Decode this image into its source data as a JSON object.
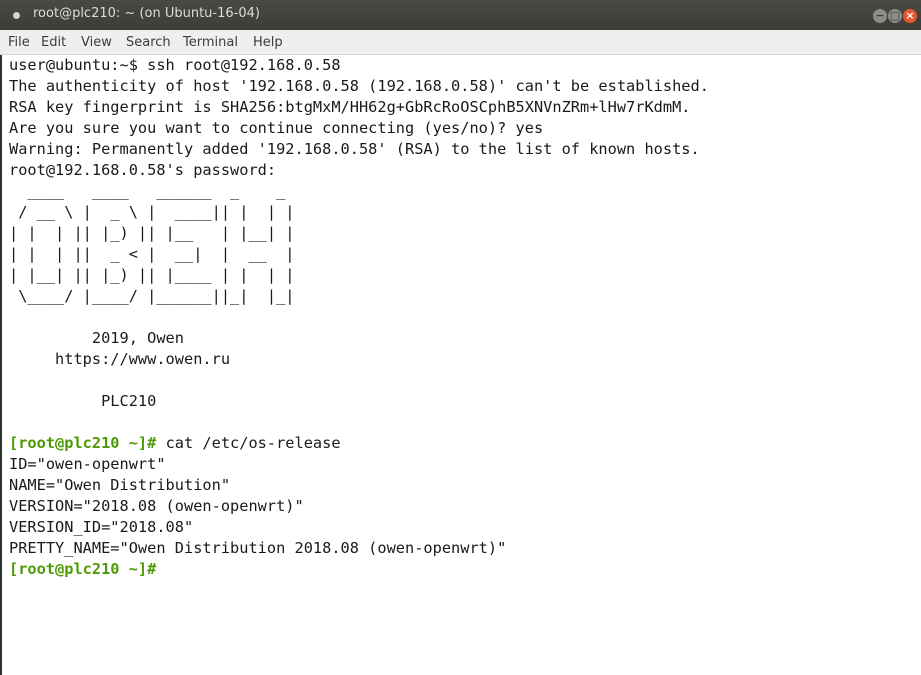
{
  "window": {
    "title": "root@plc210: ~ (on Ubuntu-16-04)",
    "controls": {
      "minimize": "−",
      "maximize": "□",
      "close": "×"
    }
  },
  "menu": {
    "items": [
      "File",
      "Edit",
      "View",
      "Search",
      "Terminal",
      "Help"
    ]
  },
  "terminal": {
    "lines": [
      "user@ubuntu:~$ ssh root@192.168.0.58",
      "The authenticity of host '192.168.0.58 (192.168.0.58)' can't be established.",
      "RSA key fingerprint is SHA256:btgMxM/HH62g+GbRcRoOSCphB5XNVnZRm+lHw7rKdmM.",
      "Are you sure you want to continue connecting (yes/no)? yes",
      "Warning: Permanently added '192.168.0.58' (RSA) to the list of known hosts.",
      "root@192.168.0.58's password:",
      "  ____   ____   ______  _    _",
      " / __ \\ |  _ \\ |  ____|| |  | |",
      "| |  | || |_) || |__   | |__| |",
      "| |  | ||  _ < |  __|  |  __  |",
      "| |__| || |_) || |____ | |  | |",
      " \\____/ |____/ |______||_|  |_|",
      "",
      "         2019, Owen",
      "     https://www.owen.ru",
      "",
      "          PLC210",
      ""
    ],
    "command_prompt": "[root@plc210 ~]#",
    "command": " cat /etc/os-release",
    "output": [
      "ID=\"owen-openwrt\"",
      "NAME=\"Owen Distribution\"",
      "VERSION=\"2018.08 (owen-openwrt)\"",
      "VERSION_ID=\"2018.08\"",
      "PRETTY_NAME=\"Owen Distribution 2018.08 (owen-openwrt)\""
    ],
    "final_prompt": "[root@plc210 ~]#"
  },
  "colors": {
    "prompt": "#4e9a06",
    "text": "#1a1a1a",
    "titlebar": "#3d3c38",
    "close_button": "#e8572c"
  }
}
